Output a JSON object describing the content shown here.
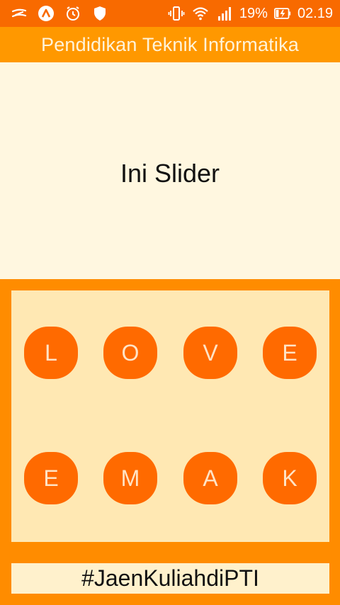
{
  "status_bar": {
    "battery_percent": "19%",
    "time": "02.19",
    "icons": [
      "zedge-icon",
      "app-logo-icon",
      "alarm-icon",
      "shield-icon",
      "vibrate-icon",
      "wifi-icon",
      "signal-icon",
      "battery-charging-icon"
    ]
  },
  "app_bar": {
    "title": "Pendidikan Teknik Informatika"
  },
  "slider": {
    "text": "Ini Slider"
  },
  "grid": {
    "row1": [
      "L",
      "O",
      "V",
      "E"
    ],
    "row2": [
      "E",
      "M",
      "A",
      "K"
    ]
  },
  "footer": {
    "hashtag": "#JaenKuliahdiPTI"
  },
  "colors": {
    "status_bar": "#F86A00",
    "app_bar": "#FF9800",
    "background": "#FF8C00",
    "slider_bg": "#FFF7E0",
    "panel_bg": "#FFE8B3",
    "button": "#FF6A00",
    "button_text": "#FFE4C6"
  }
}
